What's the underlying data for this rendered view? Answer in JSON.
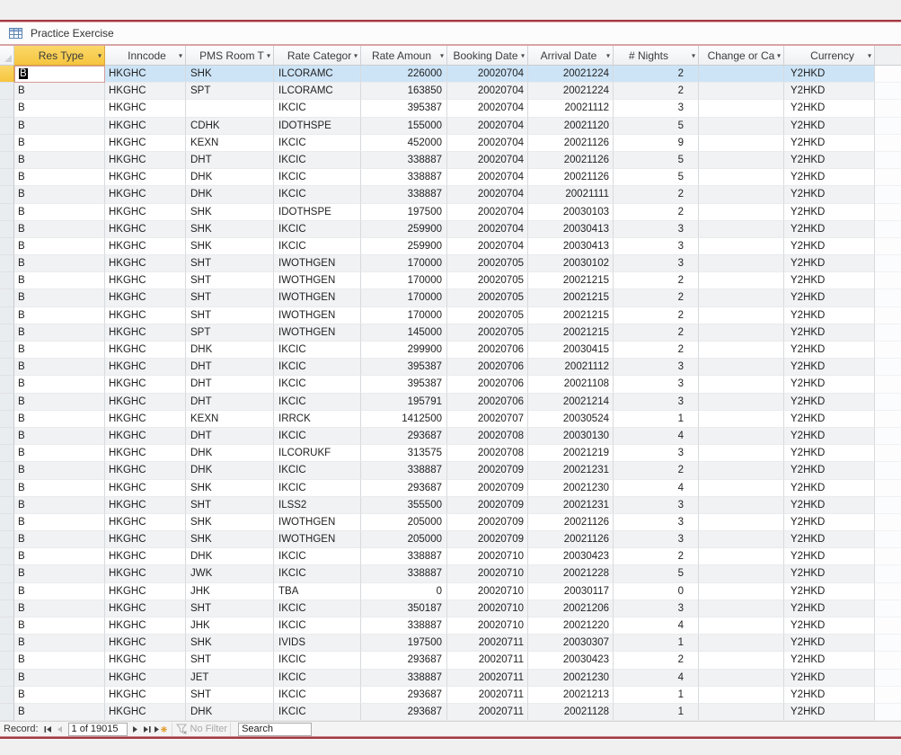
{
  "tab": {
    "title": "Practice Exercise",
    "icon": "datasheet-table-icon"
  },
  "colors": {
    "window_border_red": "#a23a42",
    "active_highlight_gold": "#f6c53e",
    "selected_row_blue": "#cde4f7",
    "stripe_gray": "#f1f2f4"
  },
  "table": {
    "columns": [
      {
        "key": "res_type",
        "label": "Res Type"
      },
      {
        "key": "inncode",
        "label": "Inncode"
      },
      {
        "key": "room_type",
        "label": "PMS Room T"
      },
      {
        "key": "rate_category",
        "label": "Rate Categor"
      },
      {
        "key": "rate_amount",
        "label": "Rate Amoun"
      },
      {
        "key": "booking_date",
        "label": "Booking Date"
      },
      {
        "key": "arrival_date",
        "label": "Arrival Date"
      },
      {
        "key": "nights",
        "label": "# Nights"
      },
      {
        "key": "change_or_cancel",
        "label": "Change or Ca"
      },
      {
        "key": "currency",
        "label": "Currency"
      }
    ],
    "sort_filter_arrow_icon": "chevron-down-icon",
    "selected_row_index": 0,
    "editing": {
      "row": 0,
      "column": "res_type",
      "selected_text": "B"
    },
    "rows": [
      [
        "B",
        "HKGHC",
        "SHK",
        "ILCORAMC",
        "226000",
        "20020704",
        "20021224",
        "2",
        "",
        "Y2HKD"
      ],
      [
        "B",
        "HKGHC",
        "SPT",
        "ILCORAMC",
        "163850",
        "20020704",
        "20021224",
        "2",
        "",
        "Y2HKD"
      ],
      [
        "B",
        "HKGHC",
        "",
        "IKCIC",
        "395387",
        "20020704",
        "20021112",
        "3",
        "",
        "Y2HKD"
      ],
      [
        "B",
        "HKGHC",
        "CDHK",
        "IDOTHSPE",
        "155000",
        "20020704",
        "20021120",
        "5",
        "",
        "Y2HKD"
      ],
      [
        "B",
        "HKGHC",
        "KEXN",
        "IKCIC",
        "452000",
        "20020704",
        "20021126",
        "9",
        "",
        "Y2HKD"
      ],
      [
        "B",
        "HKGHC",
        "DHT",
        "IKCIC",
        "338887",
        "20020704",
        "20021126",
        "5",
        "",
        "Y2HKD"
      ],
      [
        "B",
        "HKGHC",
        "DHK",
        "IKCIC",
        "338887",
        "20020704",
        "20021126",
        "5",
        "",
        "Y2HKD"
      ],
      [
        "B",
        "HKGHC",
        "DHK",
        "IKCIC",
        "338887",
        "20020704",
        "20021111",
        "2",
        "",
        "Y2HKD"
      ],
      [
        "B",
        "HKGHC",
        "SHK",
        "IDOTHSPE",
        "197500",
        "20020704",
        "20030103",
        "2",
        "",
        "Y2HKD"
      ],
      [
        "B",
        "HKGHC",
        "SHK",
        "IKCIC",
        "259900",
        "20020704",
        "20030413",
        "3",
        "",
        "Y2HKD"
      ],
      [
        "B",
        "HKGHC",
        "SHK",
        "IKCIC",
        "259900",
        "20020704",
        "20030413",
        "3",
        "",
        "Y2HKD"
      ],
      [
        "B",
        "HKGHC",
        "SHT",
        "IWOTHGEN",
        "170000",
        "20020705",
        "20030102",
        "3",
        "",
        "Y2HKD"
      ],
      [
        "B",
        "HKGHC",
        "SHT",
        "IWOTHGEN",
        "170000",
        "20020705",
        "20021215",
        "2",
        "",
        "Y2HKD"
      ],
      [
        "B",
        "HKGHC",
        "SHT",
        "IWOTHGEN",
        "170000",
        "20020705",
        "20021215",
        "2",
        "",
        "Y2HKD"
      ],
      [
        "B",
        "HKGHC",
        "SHT",
        "IWOTHGEN",
        "170000",
        "20020705",
        "20021215",
        "2",
        "",
        "Y2HKD"
      ],
      [
        "B",
        "HKGHC",
        "SPT",
        "IWOTHGEN",
        "145000",
        "20020705",
        "20021215",
        "2",
        "",
        "Y2HKD"
      ],
      [
        "B",
        "HKGHC",
        "DHK",
        "IKCIC",
        "299900",
        "20020706",
        "20030415",
        "2",
        "",
        "Y2HKD"
      ],
      [
        "B",
        "HKGHC",
        "DHT",
        "IKCIC",
        "395387",
        "20020706",
        "20021112",
        "3",
        "",
        "Y2HKD"
      ],
      [
        "B",
        "HKGHC",
        "DHT",
        "IKCIC",
        "395387",
        "20020706",
        "20021108",
        "3",
        "",
        "Y2HKD"
      ],
      [
        "B",
        "HKGHC",
        "DHT",
        "IKCIC",
        "195791",
        "20020706",
        "20021214",
        "3",
        "",
        "Y2HKD"
      ],
      [
        "B",
        "HKGHC",
        "KEXN",
        "IRRCK",
        "1412500",
        "20020707",
        "20030524",
        "1",
        "",
        "Y2HKD"
      ],
      [
        "B",
        "HKGHC",
        "DHT",
        "IKCIC",
        "293687",
        "20020708",
        "20030130",
        "4",
        "",
        "Y2HKD"
      ],
      [
        "B",
        "HKGHC",
        "DHK",
        "ILCORUKF",
        "313575",
        "20020708",
        "20021219",
        "3",
        "",
        "Y2HKD"
      ],
      [
        "B",
        "HKGHC",
        "DHK",
        "IKCIC",
        "338887",
        "20020709",
        "20021231",
        "2",
        "",
        "Y2HKD"
      ],
      [
        "B",
        "HKGHC",
        "SHK",
        "IKCIC",
        "293687",
        "20020709",
        "20021230",
        "4",
        "",
        "Y2HKD"
      ],
      [
        "B",
        "HKGHC",
        "SHT",
        "ILSS2",
        "355500",
        "20020709",
        "20021231",
        "3",
        "",
        "Y2HKD"
      ],
      [
        "B",
        "HKGHC",
        "SHK",
        "IWOTHGEN",
        "205000",
        "20020709",
        "20021126",
        "3",
        "",
        "Y2HKD"
      ],
      [
        "B",
        "HKGHC",
        "SHK",
        "IWOTHGEN",
        "205000",
        "20020709",
        "20021126",
        "3",
        "",
        "Y2HKD"
      ],
      [
        "B",
        "HKGHC",
        "DHK",
        "IKCIC",
        "338887",
        "20020710",
        "20030423",
        "2",
        "",
        "Y2HKD"
      ],
      [
        "B",
        "HKGHC",
        "JWK",
        "IKCIC",
        "338887",
        "20020710",
        "20021228",
        "5",
        "",
        "Y2HKD"
      ],
      [
        "B",
        "HKGHC",
        "JHK",
        "TBA",
        "0",
        "20020710",
        "20030117",
        "0",
        "",
        "Y2HKD"
      ],
      [
        "B",
        "HKGHC",
        "SHT",
        "IKCIC",
        "350187",
        "20020710",
        "20021206",
        "3",
        "",
        "Y2HKD"
      ],
      [
        "B",
        "HKGHC",
        "JHK",
        "IKCIC",
        "338887",
        "20020710",
        "20021220",
        "4",
        "",
        "Y2HKD"
      ],
      [
        "B",
        "HKGHC",
        "SHK",
        "IVIDS",
        "197500",
        "20020711",
        "20030307",
        "1",
        "",
        "Y2HKD"
      ],
      [
        "B",
        "HKGHC",
        "SHT",
        "IKCIC",
        "293687",
        "20020711",
        "20030423",
        "2",
        "",
        "Y2HKD"
      ],
      [
        "B",
        "HKGHC",
        "JET",
        "IKCIC",
        "338887",
        "20020711",
        "20021230",
        "4",
        "",
        "Y2HKD"
      ],
      [
        "B",
        "HKGHC",
        "SHT",
        "IKCIC",
        "293687",
        "20020711",
        "20021213",
        "1",
        "",
        "Y2HKD"
      ],
      [
        "B",
        "HKGHC",
        "DHK",
        "IKCIC",
        "293687",
        "20020711",
        "20021128",
        "1",
        "",
        "Y2HKD"
      ]
    ]
  },
  "record_nav": {
    "label": "Record:",
    "position": "1 of 19015",
    "icons": {
      "first": "first-record-icon",
      "previous": "previous-record-icon",
      "next": "next-record-icon",
      "last": "last-record-icon",
      "new": "new-record-icon",
      "filter": "filter-funnel-icon"
    },
    "filter_label": "No Filter",
    "search_value": "Search"
  }
}
